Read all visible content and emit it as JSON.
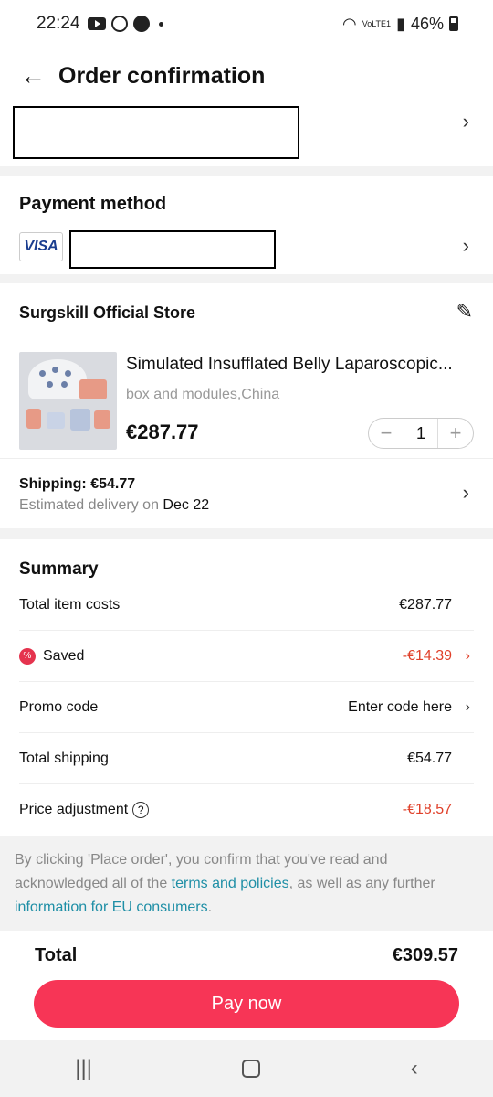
{
  "status": {
    "time": "22:24",
    "battery": "46%",
    "network": "VoLTE1"
  },
  "header": {
    "title": "Order confirmation"
  },
  "payment": {
    "title": "Payment method",
    "card_brand": "VISA"
  },
  "store": {
    "name": "Surgskill Official Store",
    "product": {
      "title": "Simulated Insufflated Belly Laparoscopic...",
      "variant": "box and modules,China",
      "price": "€287.77",
      "quantity": "1"
    },
    "shipping": {
      "label": "Shipping: €54.77",
      "delivery_prefix": "Estimated delivery on",
      "delivery_date": "Dec 22"
    }
  },
  "summary": {
    "title": "Summary",
    "rows": [
      {
        "label": "Total item costs",
        "value": "€287.77"
      },
      {
        "label": "Saved",
        "value": "-€14.39"
      },
      {
        "label": "Promo code",
        "value": "Enter code here"
      },
      {
        "label": "Total shipping",
        "value": "€54.77"
      },
      {
        "label": "Price adjustment",
        "value": "-€18.57"
      }
    ]
  },
  "disclaimer": {
    "part1": "By clicking 'Place order', you confirm that you've read and acknowledged all of the ",
    "link1": "terms and policies",
    "part2": ", as well as any further ",
    "link2": "information for EU consumers",
    "part3": "."
  },
  "total": {
    "label": "Total",
    "value": "€309.57"
  },
  "pay_button": "Pay now",
  "colors": {
    "accent": "#f73556",
    "discount": "#e0402a",
    "link": "#1f8fa6"
  }
}
